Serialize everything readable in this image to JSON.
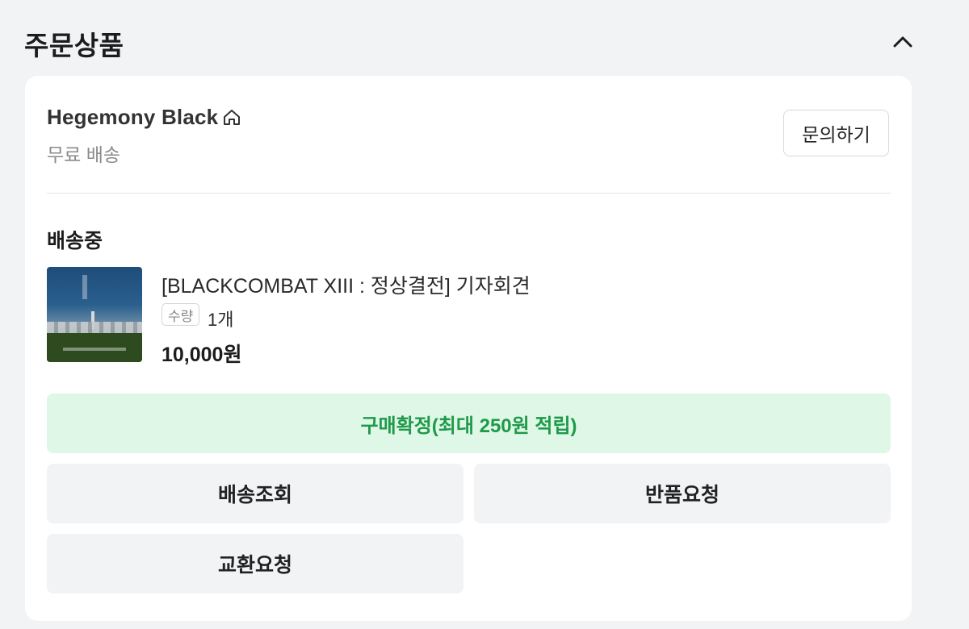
{
  "section": {
    "title": "주문상품"
  },
  "seller": {
    "name": "Hegemony Black",
    "shipping": "무료 배송",
    "inquiry_label": "문의하기"
  },
  "order": {
    "status": "배송중",
    "product": {
      "name": "[BLACKCOMBAT XIII : 정상결전] 기자회견",
      "qty_label": "수량",
      "qty_value": "1개",
      "price": "10,000원"
    }
  },
  "actions": {
    "confirm": "구매확정(최대 250원 적립)",
    "track": "배송조회",
    "return": "반품요청",
    "exchange": "교환요청"
  },
  "icons": {
    "collapse": "chevron-up-icon",
    "store": "home-icon"
  },
  "colors": {
    "confirm_bg": "#dff7e6",
    "confirm_text": "#1e9a4a",
    "gray_button": "#f2f3f5"
  }
}
